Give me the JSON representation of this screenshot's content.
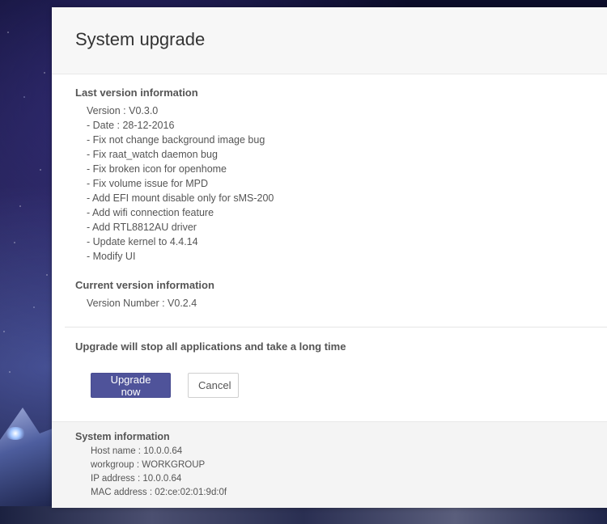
{
  "modal": {
    "title": "System upgrade"
  },
  "last_version": {
    "heading": "Last version information",
    "lines": [
      "Version : V0.3.0",
      "- Date : 28-12-2016",
      "- Fix not change background image bug",
      "- Fix raat_watch daemon bug",
      "- Fix broken icon for openhome",
      "- Fix volume issue for MPD",
      "- Add EFI mount disable only for sMS-200",
      "- Add wifi connection feature",
      "- Add RTL8812AU driver",
      "- Update kernel to 4.4.14",
      "- Modify UI"
    ]
  },
  "current_version": {
    "heading": "Current version information",
    "line": "Version Number : V0.2.4"
  },
  "upgrade": {
    "warning": "Upgrade will stop all applications and take a long time",
    "upgrade_label": "Upgrade now",
    "cancel_label": "Cancel"
  },
  "system_info": {
    "heading": "System information",
    "lines": [
      "Host name : 10.0.0.64",
      "workgroup : WORKGROUP",
      "IP address : 10.0.0.64",
      "MAC address : 02:ce:02:01:9d:0f"
    ]
  },
  "colors": {
    "primary_button": "#4f539a",
    "header_bg": "#f7f7f7",
    "footer_bg": "#f4f4f4"
  }
}
